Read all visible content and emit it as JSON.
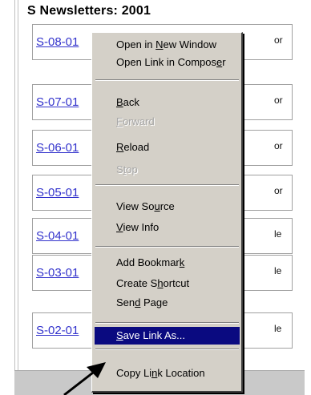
{
  "page": {
    "title": "S Newsletters: 2001",
    "rows": [
      {
        "link": "S-08-01",
        "tail": "or"
      },
      {
        "link": "S-07-01",
        "tail": "or"
      },
      {
        "link": "S-06-01",
        "tail": "or"
      },
      {
        "link": "S-05-01",
        "tail": "or"
      },
      {
        "link": "S-04-01",
        "tail": "le"
      },
      {
        "link": "S-03-01",
        "tail": "le"
      },
      {
        "link": "S-02-01",
        "tail": "le"
      }
    ]
  },
  "context_menu": {
    "items": [
      {
        "pre": "Open in ",
        "u": "N",
        "post": "ew Window",
        "enabled": true
      },
      {
        "pre": "Open Link in Compos",
        "u": "e",
        "post": "r",
        "enabled": true
      },
      {
        "pre": "",
        "u": "B",
        "post": "ack",
        "enabled": true
      },
      {
        "pre": "",
        "u": "F",
        "post": "orward",
        "enabled": false
      },
      {
        "pre": "",
        "u": "R",
        "post": "eload",
        "enabled": true
      },
      {
        "pre": "S",
        "u": "t",
        "post": "op",
        "enabled": false
      },
      {
        "pre": "View So",
        "u": "u",
        "post": "rce",
        "enabled": true
      },
      {
        "pre": "",
        "u": "V",
        "post": "iew Info",
        "enabled": true
      },
      {
        "pre": "Add Bookmar",
        "u": "k",
        "post": "",
        "enabled": true
      },
      {
        "pre": "Create S",
        "u": "h",
        "post": "ortcut",
        "enabled": true
      },
      {
        "pre": "Sen",
        "u": "d",
        "post": " Page",
        "enabled": true
      },
      {
        "pre": "",
        "u": "S",
        "post": "ave Link As...",
        "enabled": true,
        "highlighted": true
      },
      {
        "pre": "Copy Li",
        "u": "n",
        "post": "k Location",
        "enabled": true
      }
    ]
  },
  "colors": {
    "link": "#3333cc",
    "menu_bg": "#d4d0c8",
    "highlight": "#0a0a80",
    "disabled_text": "#a6a6a6"
  },
  "icons": {
    "pointer": "arrow-pointer-icon"
  }
}
